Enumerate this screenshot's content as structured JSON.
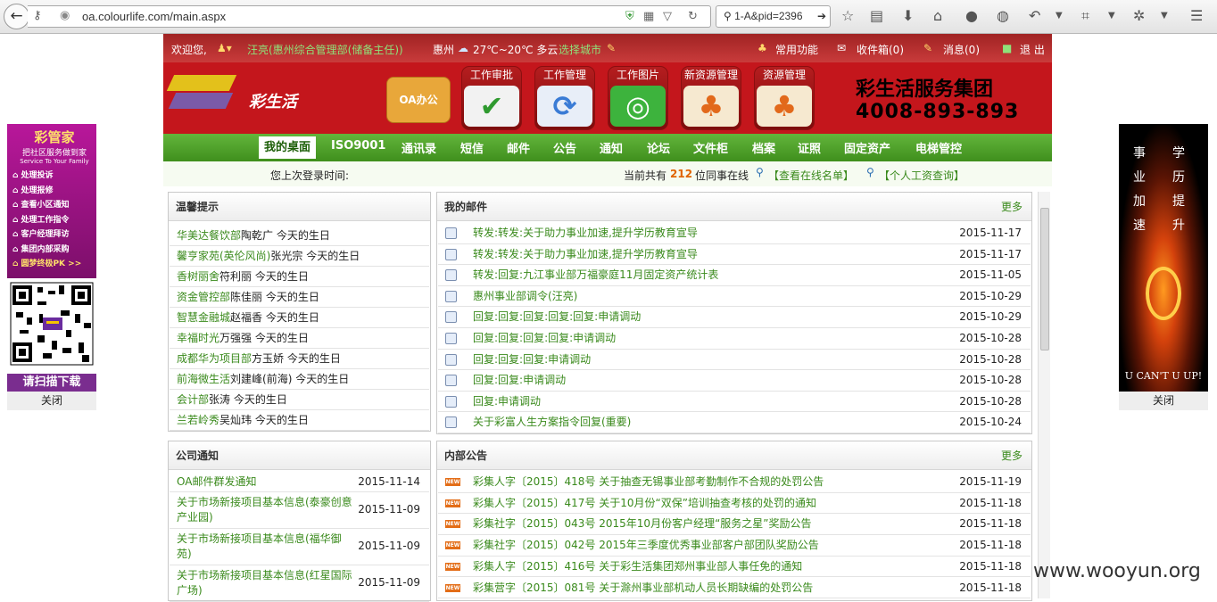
{
  "browser": {
    "url": "oa.colourlife.com/main.aspx",
    "search_text": "1-A&pid=2396"
  },
  "topbar": {
    "welcome": "欢迎您,",
    "user": "汪亮(惠州综合管理部(储备主任))",
    "city": "惠州",
    "weather": "27℃~20℃ 多云",
    "choose_city": "选择城市",
    "common_functions": "常用功能",
    "inbox": "收件箱(0)",
    "messages": "消息(0)",
    "logout": "退 出"
  },
  "banner": {
    "logo_text": "彩生活",
    "oa_label": "OA办公",
    "buttons": [
      "工作审批",
      "工作管理",
      "工作图片",
      "新资源管理",
      "资源管理"
    ],
    "company": "彩生活服务集团",
    "phone": "4008-893-893"
  },
  "nav": [
    "我的桌面",
    "ISO9001",
    "通讯录",
    "短信",
    "邮件",
    "公告",
    "通知",
    "论坛",
    "文件柜",
    "档案",
    "证照",
    "固定资产",
    "电梯管控"
  ],
  "infobar": {
    "last_login": "您上次登录时间:",
    "online_prefix": "当前共有",
    "online_count": "212",
    "online_suffix": "位同事在线",
    "view_online": "【查看在线名单】",
    "salary": "【个人工资查询】"
  },
  "tips": {
    "title": "温馨提示",
    "items": [
      {
        "dept": "华美达餐饮部",
        "rest": "陶乾广 今天的生日"
      },
      {
        "dept": "馨亨家苑(英伦风尚)",
        "rest": "张光宗 今天的生日"
      },
      {
        "dept": "香树丽舍",
        "rest": "符利丽 今天的生日"
      },
      {
        "dept": "资金管控部",
        "rest": "陈佳丽 今天的生日"
      },
      {
        "dept": "智慧金融城",
        "rest": "赵福香 今天的生日"
      },
      {
        "dept": "幸福时光",
        "rest": "万强强 今天的生日"
      },
      {
        "dept": "成都华为项目部",
        "rest": "方玉娇 今天的生日"
      },
      {
        "dept": "前海微生活",
        "rest": "刘建峰(前海) 今天的生日"
      },
      {
        "dept": "会计部",
        "rest": "张涛 今天的生日"
      },
      {
        "dept": "兰若岭秀",
        "rest": "吴灿玮 今天的生日"
      }
    ]
  },
  "mail": {
    "title": "我的邮件",
    "more": "更多",
    "items": [
      {
        "title": "转发:转发:关于助力事业加速,提升学历教育宣导",
        "date": "2015-11-17"
      },
      {
        "title": "转发:转发:关于助力事业加速,提升学历教育宣导",
        "date": "2015-11-17"
      },
      {
        "title": "转发:回复:九江事业部万福豪庭11月固定资产统计表",
        "date": "2015-11-05"
      },
      {
        "title": "惠州事业部调令(汪亮)",
        "date": "2015-10-29"
      },
      {
        "title": "回复:回复:回复:回复:回复:申请调动",
        "date": "2015-10-29"
      },
      {
        "title": "回复:回复:回复:回复:申请调动",
        "date": "2015-10-28"
      },
      {
        "title": "回复:回复:回复:申请调动",
        "date": "2015-10-28"
      },
      {
        "title": "回复:回复:申请调动",
        "date": "2015-10-28"
      },
      {
        "title": "回复:申请调动",
        "date": "2015-10-28"
      },
      {
        "title": "关于彩富人生方案指令回复(重要)",
        "date": "2015-10-24"
      }
    ]
  },
  "company_notice": {
    "title": "公司通知",
    "items": [
      {
        "title": "OA邮件群发通知",
        "date": "2015-11-14"
      },
      {
        "title": "关于市场新接项目基本信息(泰豪创意产业园)",
        "date": "2015-11-09"
      },
      {
        "title": "关于市场新接项目基本信息(福华御苑)",
        "date": "2015-11-09"
      },
      {
        "title": "关于市场新接项目基本信息(红星国际广场)",
        "date": "2015-11-09"
      }
    ]
  },
  "internal_notice": {
    "title": "内部公告",
    "more": "更多",
    "new_badge": "NEW",
    "items": [
      {
        "title": "彩集人字〔2015〕418号 关于抽查无锡事业部考勤制作不合规的处罚公告",
        "date": "2015-11-19"
      },
      {
        "title": "彩集人字〔2015〕417号 关于10月份“双保”培训抽查考核的处罚的通知",
        "date": "2015-11-18"
      },
      {
        "title": "彩集社字〔2015〕043号 2015年10月份客户经理“服务之星”奖励公告",
        "date": "2015-11-18"
      },
      {
        "title": "彩集社字〔2015〕042号 2015年三季度优秀事业部客户部团队奖励公告",
        "date": "2015-11-18"
      },
      {
        "title": "彩集人字〔2015〕416号 关于彩生活集团郑州事业部人事任免的通知",
        "date": "2015-11-18"
      },
      {
        "title": "彩集营字〔2015〕081号 关于滁州事业部机动人员长期缺编的处罚公告",
        "date": "2015-11-18"
      }
    ]
  },
  "left_ad": {
    "title": "彩管家",
    "sub1": "把社区服务做到家",
    "sub2": "Service To Your Family",
    "items": [
      "处理投诉",
      "处理报修",
      "查看小区通知",
      "处理工作指令",
      "客户经理拜访",
      "集团内部采购",
      "圆梦终极PK >>"
    ],
    "scan": "请扫描下载",
    "close": "关闭"
  },
  "right_ad": {
    "col1": [
      "事",
      "业",
      "加",
      "速"
    ],
    "col2": [
      "学",
      "历",
      "提",
      "升"
    ],
    "slogan": "U CAN'T  U UP!",
    "close": "关闭"
  },
  "watermark": "www.wooyun.org"
}
